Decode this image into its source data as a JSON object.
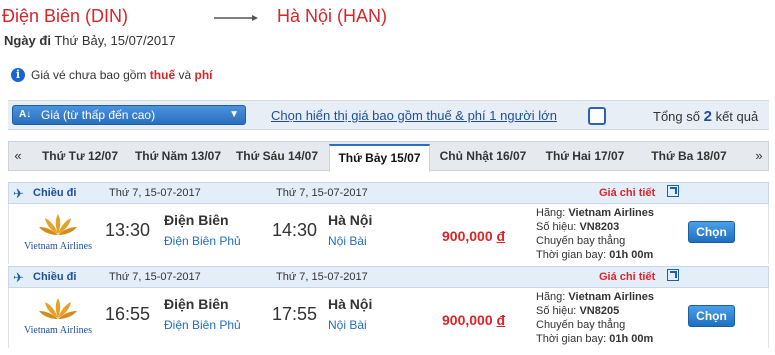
{
  "route": {
    "from": "Điện Biên (DIN)",
    "to": "Hà Nội (HAN)"
  },
  "depart": {
    "label": "Ngày đi",
    "value": "Thứ Bảy, 15/07/2017"
  },
  "notice": {
    "prefix": "Giá vé chưa bao gồm",
    "tax": "thuế",
    "and": "và",
    "fee": "phí"
  },
  "sort": {
    "selected": "Giá (từ thấp đến cao)"
  },
  "include_link": "Chọn hiển thị giá bao gồm thuế & phí 1 người lớn",
  "total": {
    "prefix": "Tổng số",
    "count": "2",
    "suffix": "kết quả"
  },
  "dates": [
    "Thứ Tư 12/07",
    "Thứ Năm 13/07",
    "Thứ Sáu 14/07",
    "Thứ Bảy 15/07",
    "Chủ Nhật 16/07",
    "Thứ Hai 17/07",
    "Thứ Ba 18/07"
  ],
  "active_date_index": 3,
  "flights": [
    {
      "direction": "Chiều đi",
      "dep_date": "Thứ 7, 15-07-2017",
      "arr_date": "Thứ 7, 15-07-2017",
      "detail_link": "Giá chi tiết",
      "airline_logo": "Vietnam Airlines",
      "dep_time": "13:30",
      "dep_city": "Điện Biên",
      "dep_airport": "Điện Biên Phủ",
      "arr_time": "14:30",
      "arr_city": "Hà Nội",
      "arr_airport": "Nội Bài",
      "price": "900,000",
      "currency": "đ",
      "airline_label": "Hãng:",
      "airline": "Vietnam Airlines",
      "flight_no_label": "Số hiệu:",
      "flight_no": "VN8203",
      "type": "Chuyến bay thẳng",
      "duration_label": "Thời gian bay:",
      "duration": "01h 00m",
      "button": "Chọn"
    },
    {
      "direction": "Chiều đi",
      "dep_date": "Thứ 7, 15-07-2017",
      "arr_date": "Thứ 7, 15-07-2017",
      "detail_link": "Giá chi tiết",
      "airline_logo": "Vietnam Airlines",
      "dep_time": "16:55",
      "dep_city": "Điện Biên",
      "dep_airport": "Điện Biên Phủ",
      "arr_time": "17:55",
      "arr_city": "Hà Nội",
      "arr_airport": "Nội Bài",
      "price": "900,000",
      "currency": "đ",
      "airline_label": "Hãng:",
      "airline": "Vietnam Airlines",
      "flight_no_label": "Số hiệu:",
      "flight_no": "VN8205",
      "type": "Chuyến bay thẳng",
      "duration_label": "Thời gian bay:",
      "duration": "01h 00m",
      "button": "Chọn"
    }
  ],
  "colors": {
    "accent_red": "#d9252a",
    "link_blue": "#1f4e9c",
    "button_blue": "#1f6fbf"
  }
}
